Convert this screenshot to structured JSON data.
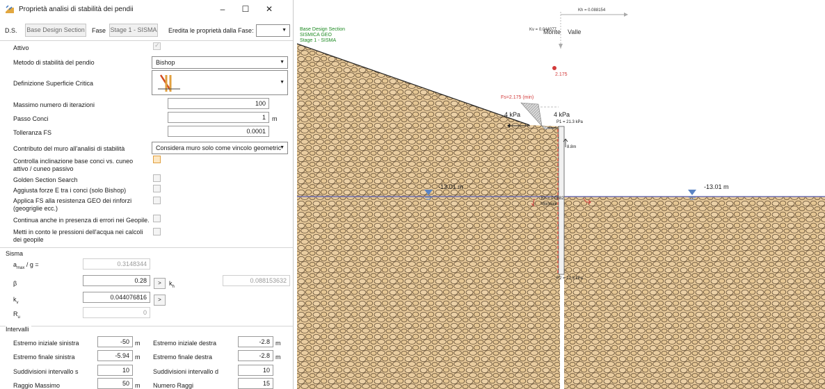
{
  "window": {
    "title": "Proprietà analisi di stabilità dei pendii",
    "minimize": "–",
    "maximize": "☐",
    "close": "✕"
  },
  "stage": {
    "ds_label": "D.S.",
    "ds_button": "Base Design Section",
    "fase_label": "Fase",
    "fase_button": "Stage 1 - SISMA",
    "inherit_label": "Eredita le proprietà dalla Fase:",
    "inherit_value": ""
  },
  "props": {
    "attivo": "Attivo",
    "metodo": "Metodo di stabilità del pendio",
    "metodo_value": "Bishop",
    "superficie": "Definizione Superficie Critica",
    "iterazioni": "Massimo numero di iterazioni",
    "iterazioni_value": "100",
    "passo": "Passo Conci",
    "passo_value": "1",
    "passo_unit": "m",
    "tolleranza": "Tolleranza FS",
    "tolleranza_value": "0.0001",
    "contributo": "Contributo del muro all'analisi di stabilità",
    "contributo_value": "Considera muro solo come vincolo geometric",
    "controlla": "Controlla inclinazione base conci vs. cuneo attivo / cuneo passivo",
    "golden": "Golden Section Search",
    "aggiusta": "Aggiusta forze E tra i conci (solo Bishop)",
    "applica": "Applica FS alla resistenza GEO dei rinforzi (geogriglie ecc.)",
    "continua": "Continua anche in presenza di errori nei Geopile.",
    "metti": "Metti in conto le pressioni dell'acqua nei calcoli dei geopile"
  },
  "sisma": {
    "header": "Sisma",
    "amax_label": "a",
    "amax_sub": "max",
    "amax_suffix": " / g =",
    "amax_value": "0.3148344",
    "beta_label": "β",
    "beta_value": "0.28",
    "beta_btn": ">",
    "kh_label": "k",
    "kh_sub": "h",
    "kh_value": "0.088153632",
    "kv_label": "k",
    "kv_sub": "v",
    "kv_value": "0.044076816",
    "kv_btn": ">",
    "ru_label": "R",
    "ru_sub": "u",
    "ru_value": "0"
  },
  "intervalli": {
    "header": "Intervalli",
    "rows": [
      {
        "l_label": "Estremo iniziale sinistra",
        "l_value": "-50",
        "l_unit": "m",
        "r_label": "Estremo iniziale destra",
        "r_value": "-2.8",
        "r_unit": "m"
      },
      {
        "l_label": "Estremo finale sinistra",
        "l_value": "-5.94",
        "l_unit": "m",
        "r_label": "Estremo finale destra",
        "r_value": "-2.8",
        "r_unit": "m"
      },
      {
        "l_label": "Suddivisioni intervallo s",
        "l_value": "10",
        "l_unit": "",
        "r_label": "Suddivisioni intervallo d",
        "r_value": "10",
        "r_unit": ""
      },
      {
        "l_label": "Raggio Massimo",
        "l_value": "50",
        "l_unit": "m",
        "r_label": "Numero Raggi",
        "r_value": "15",
        "r_unit": ""
      }
    ]
  },
  "canvas": {
    "legend_1": "Base Design Section",
    "legend_2": "SISMICA GEO",
    "legend_3": "Stage 1 - SISMA",
    "kh_arrow": "Kh = 0.088154",
    "kv_arrow": "Kv = 0.044077",
    "monte": "Monte",
    "valle": "Valle",
    "fs_value": "2.175",
    "fs_min": "Fs=2.175 (min)",
    "load_left": "4 kPa",
    "load_right": "4 kPa",
    "p1": "P1 = 21.3 kPa",
    "depth": "8.8m",
    "water_left": "-13.01 m",
    "water_right": "-13.01 m",
    "kh_wall": "Kh = 0.0882",
    "manuale": "Manuale",
    "p2": "P2 = 21.3 kPa",
    "colors": {
      "soil": "#e7c99a",
      "cobble": "#5e4a32",
      "water_line": "#6e6eb0",
      "legend_text": "#1d8a22",
      "fs_red": "#d23a3a"
    }
  },
  "icons": [
    "app-icon",
    "dropdown-arrow-icon",
    "critical-surface-icon",
    "check-icon",
    "water-table-icon",
    "arrow-icon"
  ]
}
